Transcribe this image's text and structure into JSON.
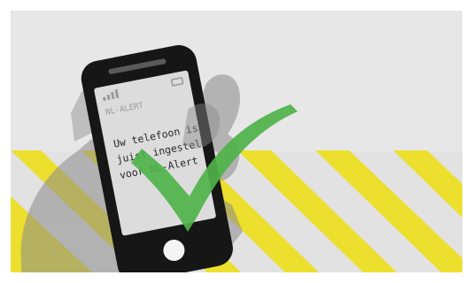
{
  "phone": {
    "status_label": "NL-ALERT",
    "message_lines": [
      "Uw telefoon is",
      "juist ingesteld",
      "voor NL-Alert"
    ]
  },
  "colors": {
    "background": "#e2e2e2",
    "stripe_yellow": "#ecdf2e",
    "phone_body": "#161616",
    "screen": "#dcdcdc",
    "checkmark": "#4fb24a",
    "hand": "#8a8a8a"
  },
  "icons": [
    "signal-icon",
    "battery-icon",
    "checkmark-icon",
    "home-button-icon",
    "hand-icon"
  ]
}
